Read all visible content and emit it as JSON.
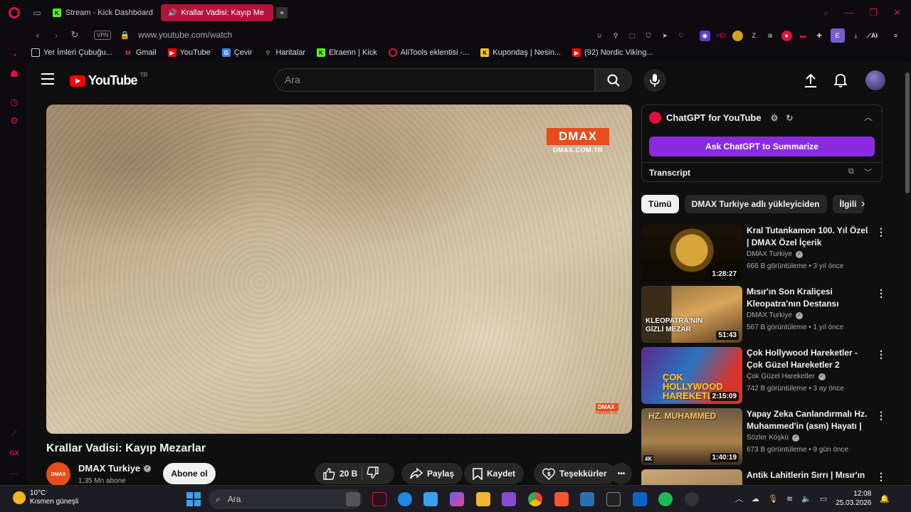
{
  "browser": {
    "tabs": [
      {
        "label": "Stream - Kick Dashboard",
        "active": false
      },
      {
        "label": "Krallar Vadisi: Kayıp Me",
        "active": true
      }
    ],
    "url": "www.youtube.com/watch",
    "vpn_label": "VPN",
    "ai_label": "AI",
    "bookmarks": [
      {
        "label": "Yer İmleri Çubuğu..."
      },
      {
        "label": "Gmail"
      },
      {
        "label": "YouTube"
      },
      {
        "label": "Çevir"
      },
      {
        "label": "Haritalar"
      },
      {
        "label": "Elraenn | Kick"
      },
      {
        "label": "AliTools eklentisi -..."
      },
      {
        "label": "Kupondaş | Nesin..."
      },
      {
        "label": "(92) Nordic Viking..."
      }
    ],
    "sidebar_footer": "GX"
  },
  "youtube": {
    "logo_text": "YouTube",
    "country_code": "TR",
    "search_placeholder": "Ara",
    "player": {
      "watermark": "DMAX",
      "watermark_url": "DMAX.COM.TR",
      "corner_logo": "DMAX",
      "corner_sub": "ABONE OL"
    },
    "video": {
      "title": "Krallar Vadisi: Kayıp Mezarlar",
      "channel": "DMAX Turkiye",
      "channel_avatar": "DMAX",
      "subscribers": "1,35 Mn abone",
      "subscribe_label": "Abone ol",
      "likes": "20 B",
      "share_label": "Paylaş",
      "save_label": "Kaydet",
      "thanks_label": "Teşekkürler",
      "more_label": "•••"
    },
    "chatgpt": {
      "title": "ChatGPT for YouTube",
      "ask_label": "Ask ChatGPT to Summarize",
      "transcript_label": "Transcript"
    },
    "chips": [
      {
        "label": "Tümü",
        "active": true
      },
      {
        "label": "DMAX Turkiye adlı yükleyiciden",
        "active": false
      },
      {
        "label": "İlgili",
        "active": false
      }
    ],
    "recommendations": [
      {
        "title": "Kral Tutankamon 100. Yıl Özel | DMAX Özel İçerik",
        "channel": "DMAX Turkiye",
        "meta": "666 B görüntüleme • 3 yıl önce",
        "duration": "1:28:27"
      },
      {
        "title": "Mısır'ın Son Kraliçesi Kleopatra'nın Destansı Hikaye...",
        "channel": "DMAX Turkiye",
        "meta": "567 B görüntüleme • 1 yıl önce",
        "duration": "51:43",
        "thumb_caption": "KLEOPATRA'NIN GİZLİ MEZAR"
      },
      {
        "title": "Çok Hollywood Hareketler - Çok Güzel Hareketler 2",
        "channel": "Çok Güzel Hareketler",
        "meta": "742 B görüntüleme • 3 ay önce",
        "duration": "2:15:09",
        "thumb_caption": "ÇOK HOLLYWOOD HAREKETLER"
      },
      {
        "title": "Yapay Zeka Canlandırmalı Hz. Muhammed'in (asm) Hayatı | ...",
        "channel": "Sözler Köşkü",
        "meta": "673 B görüntüleme • 9 gün önce",
        "duration": "1:40:19",
        "thumb_caption": "HZ. MUHAMMED",
        "badge": "4K"
      },
      {
        "title": "Antik Lahitlerin Sırrı | Mısır'ın",
        "channel": "",
        "meta": "",
        "duration": ""
      }
    ]
  },
  "taskbar": {
    "temperature": "10°C",
    "weather": "Kısmen güneşli",
    "search_placeholder": "Ara",
    "time": "12:08",
    "date": "25.03.2026"
  }
}
